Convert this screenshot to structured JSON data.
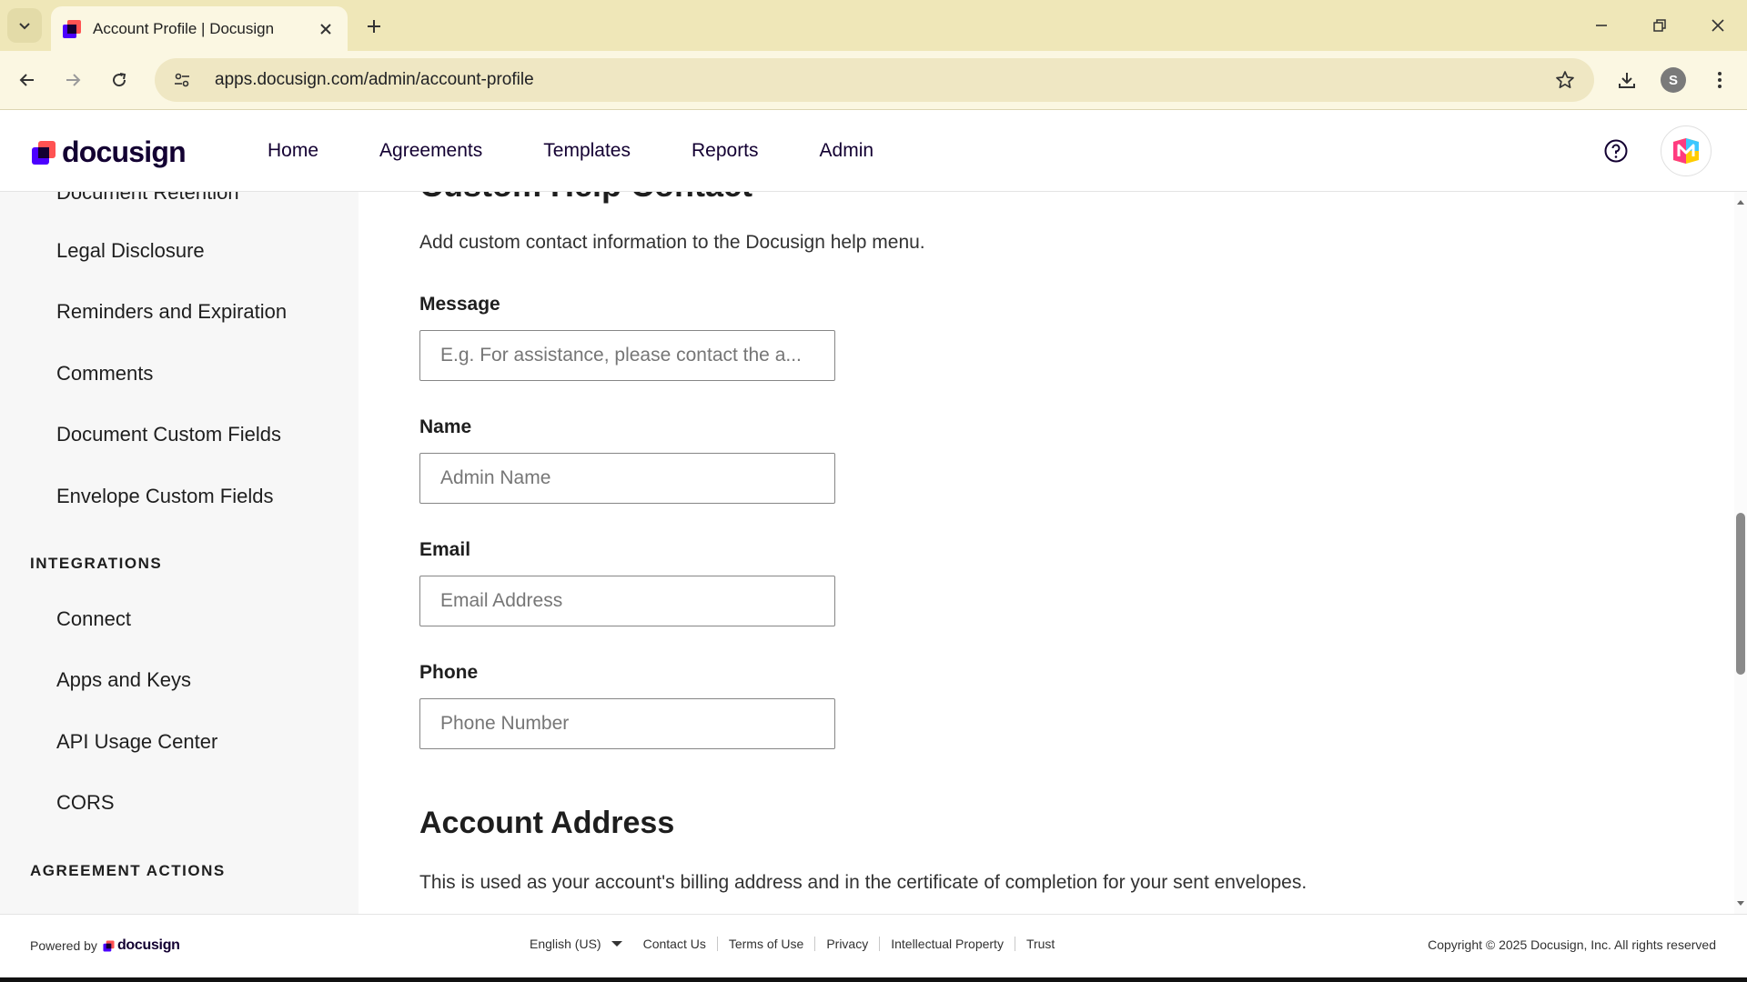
{
  "browser": {
    "tab_title": "Account Profile | Docusign",
    "url": "apps.docusign.com/admin/account-profile",
    "profile_initial": "S"
  },
  "header": {
    "logo_text": "docusign",
    "nav": [
      "Home",
      "Agreements",
      "Templates",
      "Reports",
      "Admin"
    ]
  },
  "sidebar": {
    "cut_item": "Document Retention",
    "items_top": [
      "Legal Disclosure",
      "Reminders and Expiration",
      "Comments",
      "Document Custom Fields",
      "Envelope Custom Fields"
    ],
    "heading_integrations": "INTEGRATIONS",
    "items_integrations": [
      "Connect",
      "Apps and Keys",
      "API Usage Center",
      "CORS"
    ],
    "heading_agreement_actions": "AGREEMENT ACTIONS"
  },
  "main": {
    "cut_section_title": "Custom Help Contact",
    "description": "Add custom contact information to the Docusign help menu.",
    "fields": {
      "message": {
        "label": "Message",
        "placeholder": "E.g. For assistance, please contact the a..."
      },
      "name": {
        "label": "Name",
        "placeholder": "Admin Name"
      },
      "email": {
        "label": "Email",
        "placeholder": "Email Address"
      },
      "phone": {
        "label": "Phone",
        "placeholder": "Phone Number"
      }
    },
    "address_title": "Account Address",
    "address_description": "This is used as your account's billing address and in the certificate of completion for your sent envelopes."
  },
  "footer": {
    "powered_by": "Powered by",
    "logo_text": "docusign",
    "language": "English (US)",
    "links": [
      "Contact Us",
      "Terms of Use",
      "Privacy",
      "Intellectual Property",
      "Trust"
    ],
    "copyright": "Copyright © 2025 Docusign, Inc. All rights reserved"
  },
  "colors": {
    "brand_dark": "#130032",
    "brand_red": "#ff5252",
    "brand_purple": "#4c00ff",
    "chrome_bg": "#efe7b8"
  }
}
